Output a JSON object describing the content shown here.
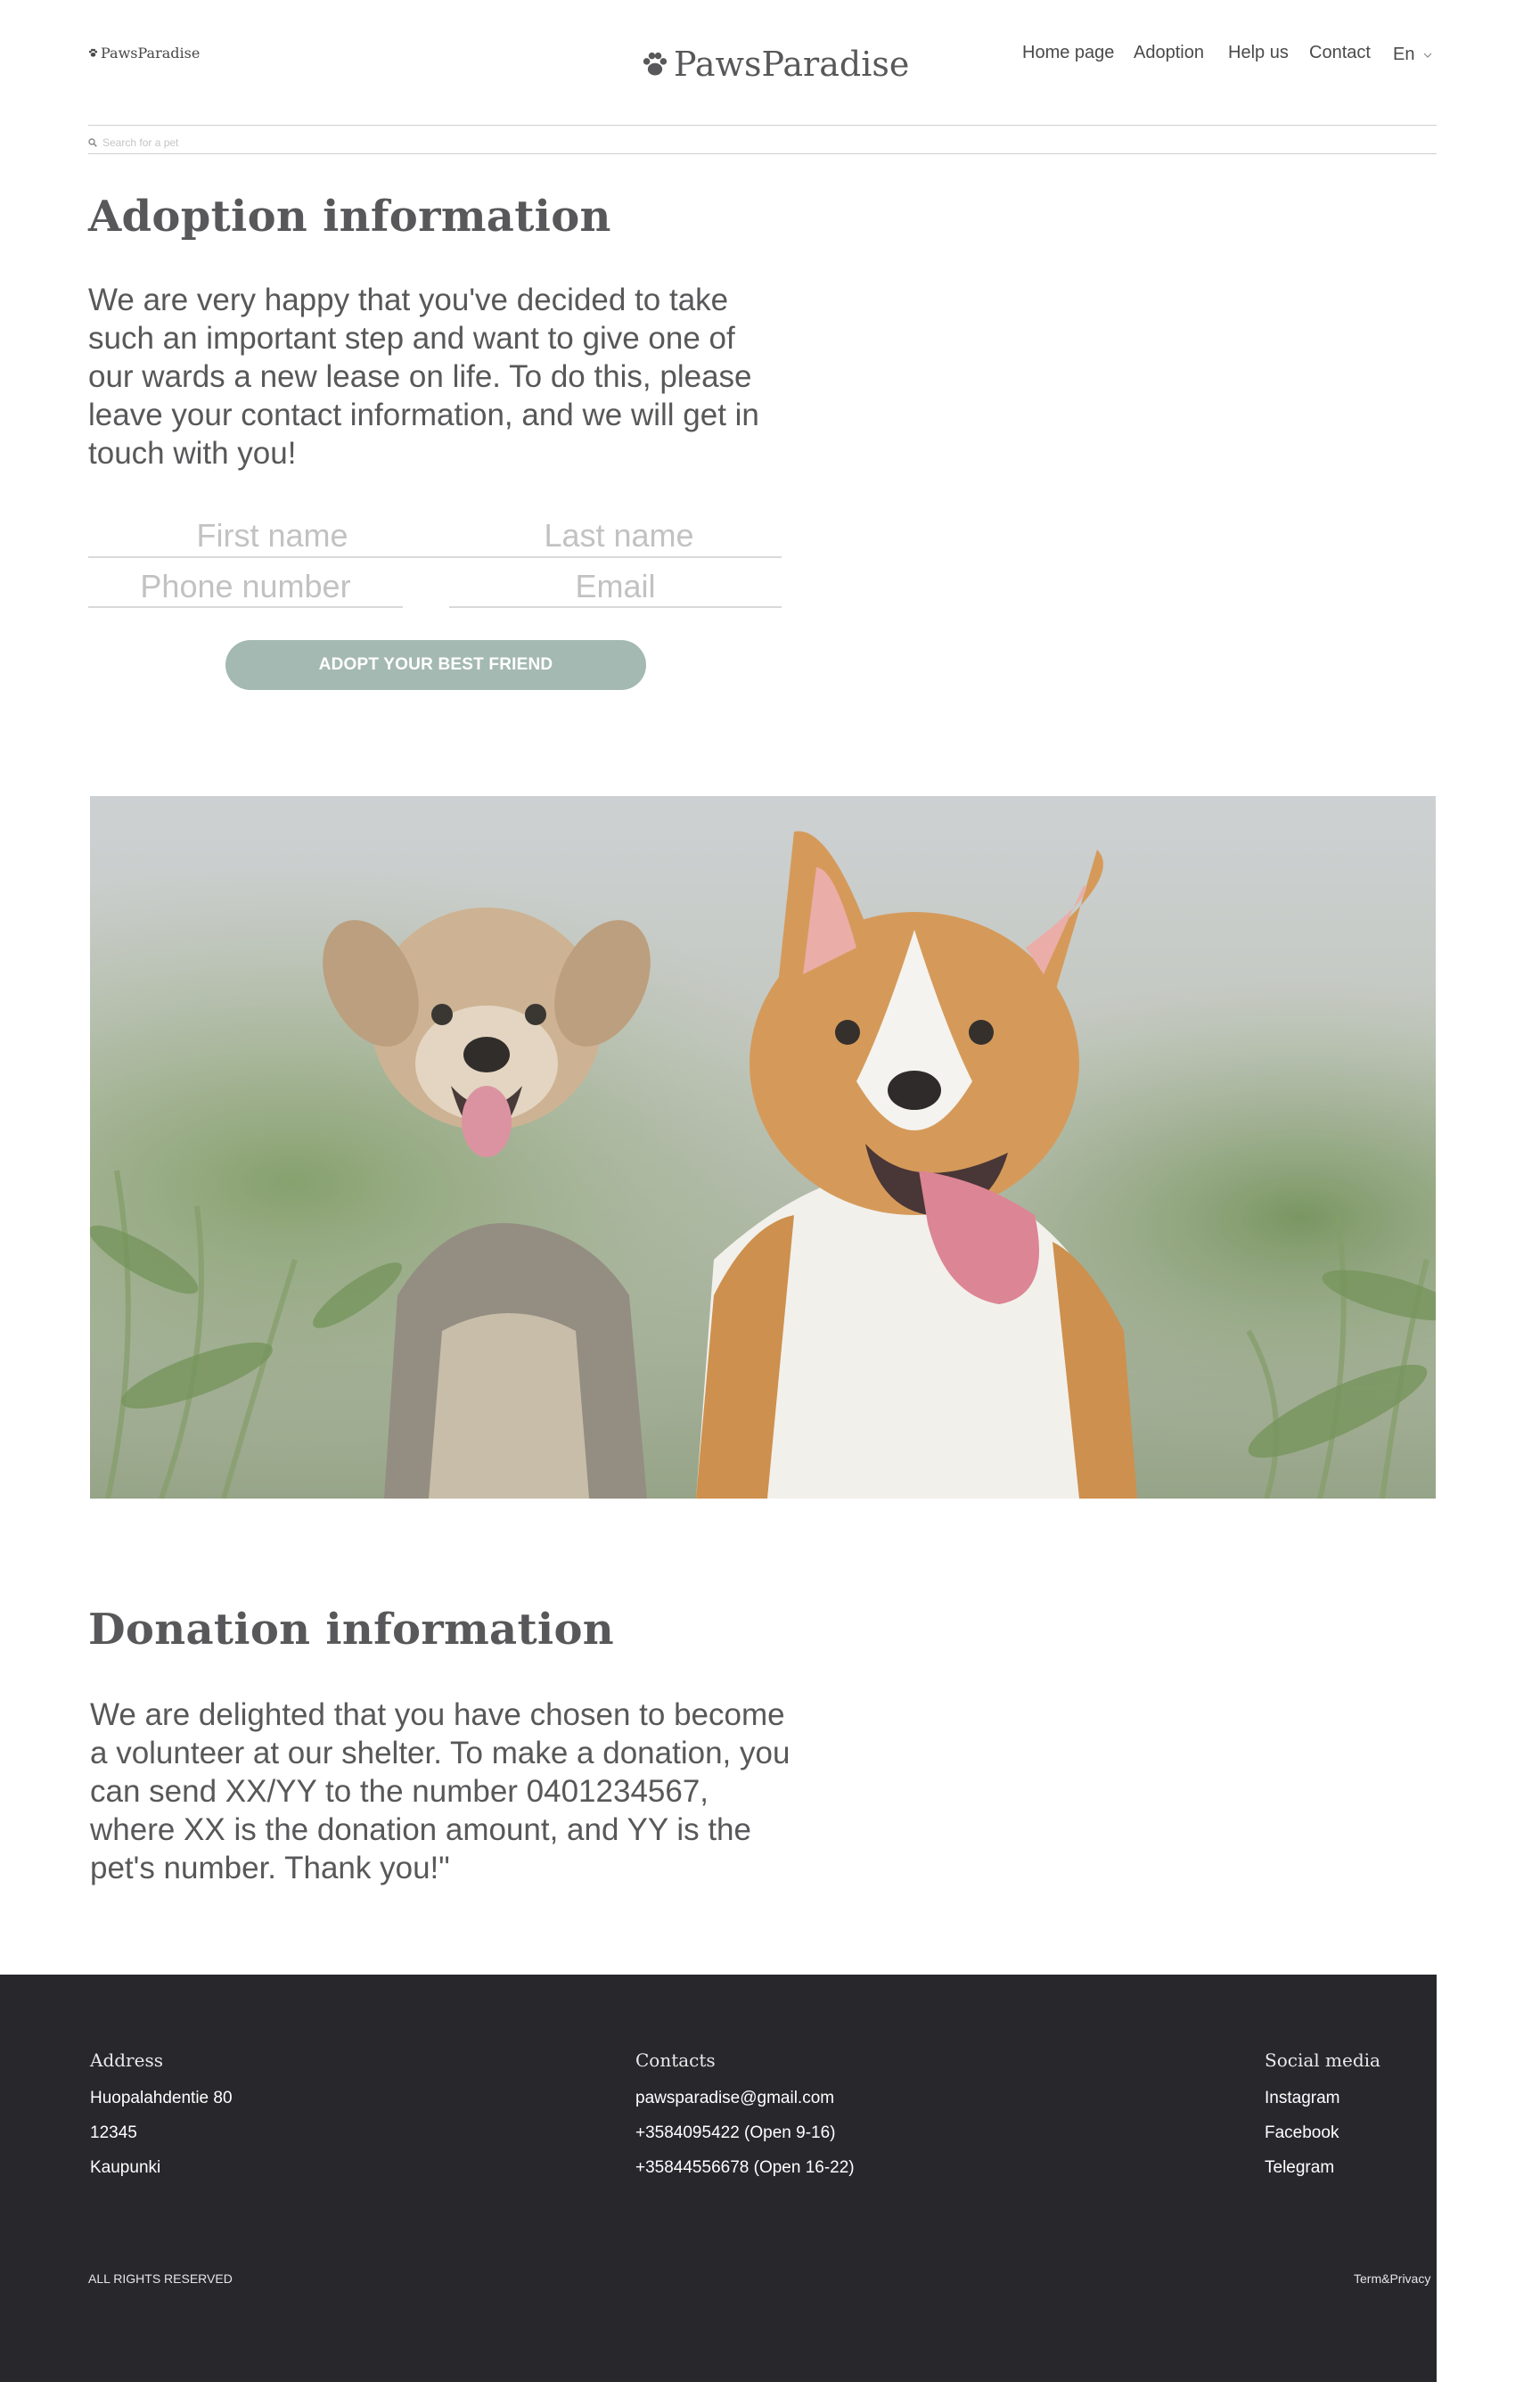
{
  "header": {
    "brand": "PawsParadise",
    "nav": [
      "Home page",
      "Adoption",
      "Help us",
      "Contact"
    ],
    "language": "En",
    "search_placeholder": "Search for a pet"
  },
  "adoption": {
    "title": "Adoption information",
    "text": "We are very happy that you've decided to take such an important step and want to give one of our wards a new lease on life. To do this, please leave your contact information, and we will get in touch with you!",
    "fields": {
      "first_name": "First name",
      "last_name": "Last name",
      "phone": "Phone number",
      "email": "Email"
    },
    "button": "ADOPT YOUR BEST FRIEND"
  },
  "donation": {
    "title": "Donation information",
    "text": "We are delighted that you have chosen to become a volunteer at our shelter. To make a donation, you can send XX/YY to the number 0401234567, where XX is the donation amount, and YY is the pet's number. Thank you!\""
  },
  "footer": {
    "address": {
      "heading": "Address",
      "lines": [
        "Huopalahdentie 80",
        "12345",
        "Kaupunki"
      ]
    },
    "contacts": {
      "heading": "Contacts",
      "lines": [
        "pawsparadise@gmail.com",
        "+3584095422 (Open 9-16)",
        "+35844556678 (Open 16-22)"
      ]
    },
    "social": {
      "heading": "Social media",
      "links": [
        "Instagram",
        "Facebook",
        "Telegram"
      ]
    },
    "rights": "ALL RIGHTS RESERVED",
    "terms": "Term&Privacy"
  },
  "icons": {
    "brand": "paw-icon",
    "search": "search-icon",
    "language": "chevron-down-icon"
  },
  "colors": {
    "accent": "#a4b9b1",
    "text": "#58585a",
    "footer_bg": "#28272c"
  }
}
